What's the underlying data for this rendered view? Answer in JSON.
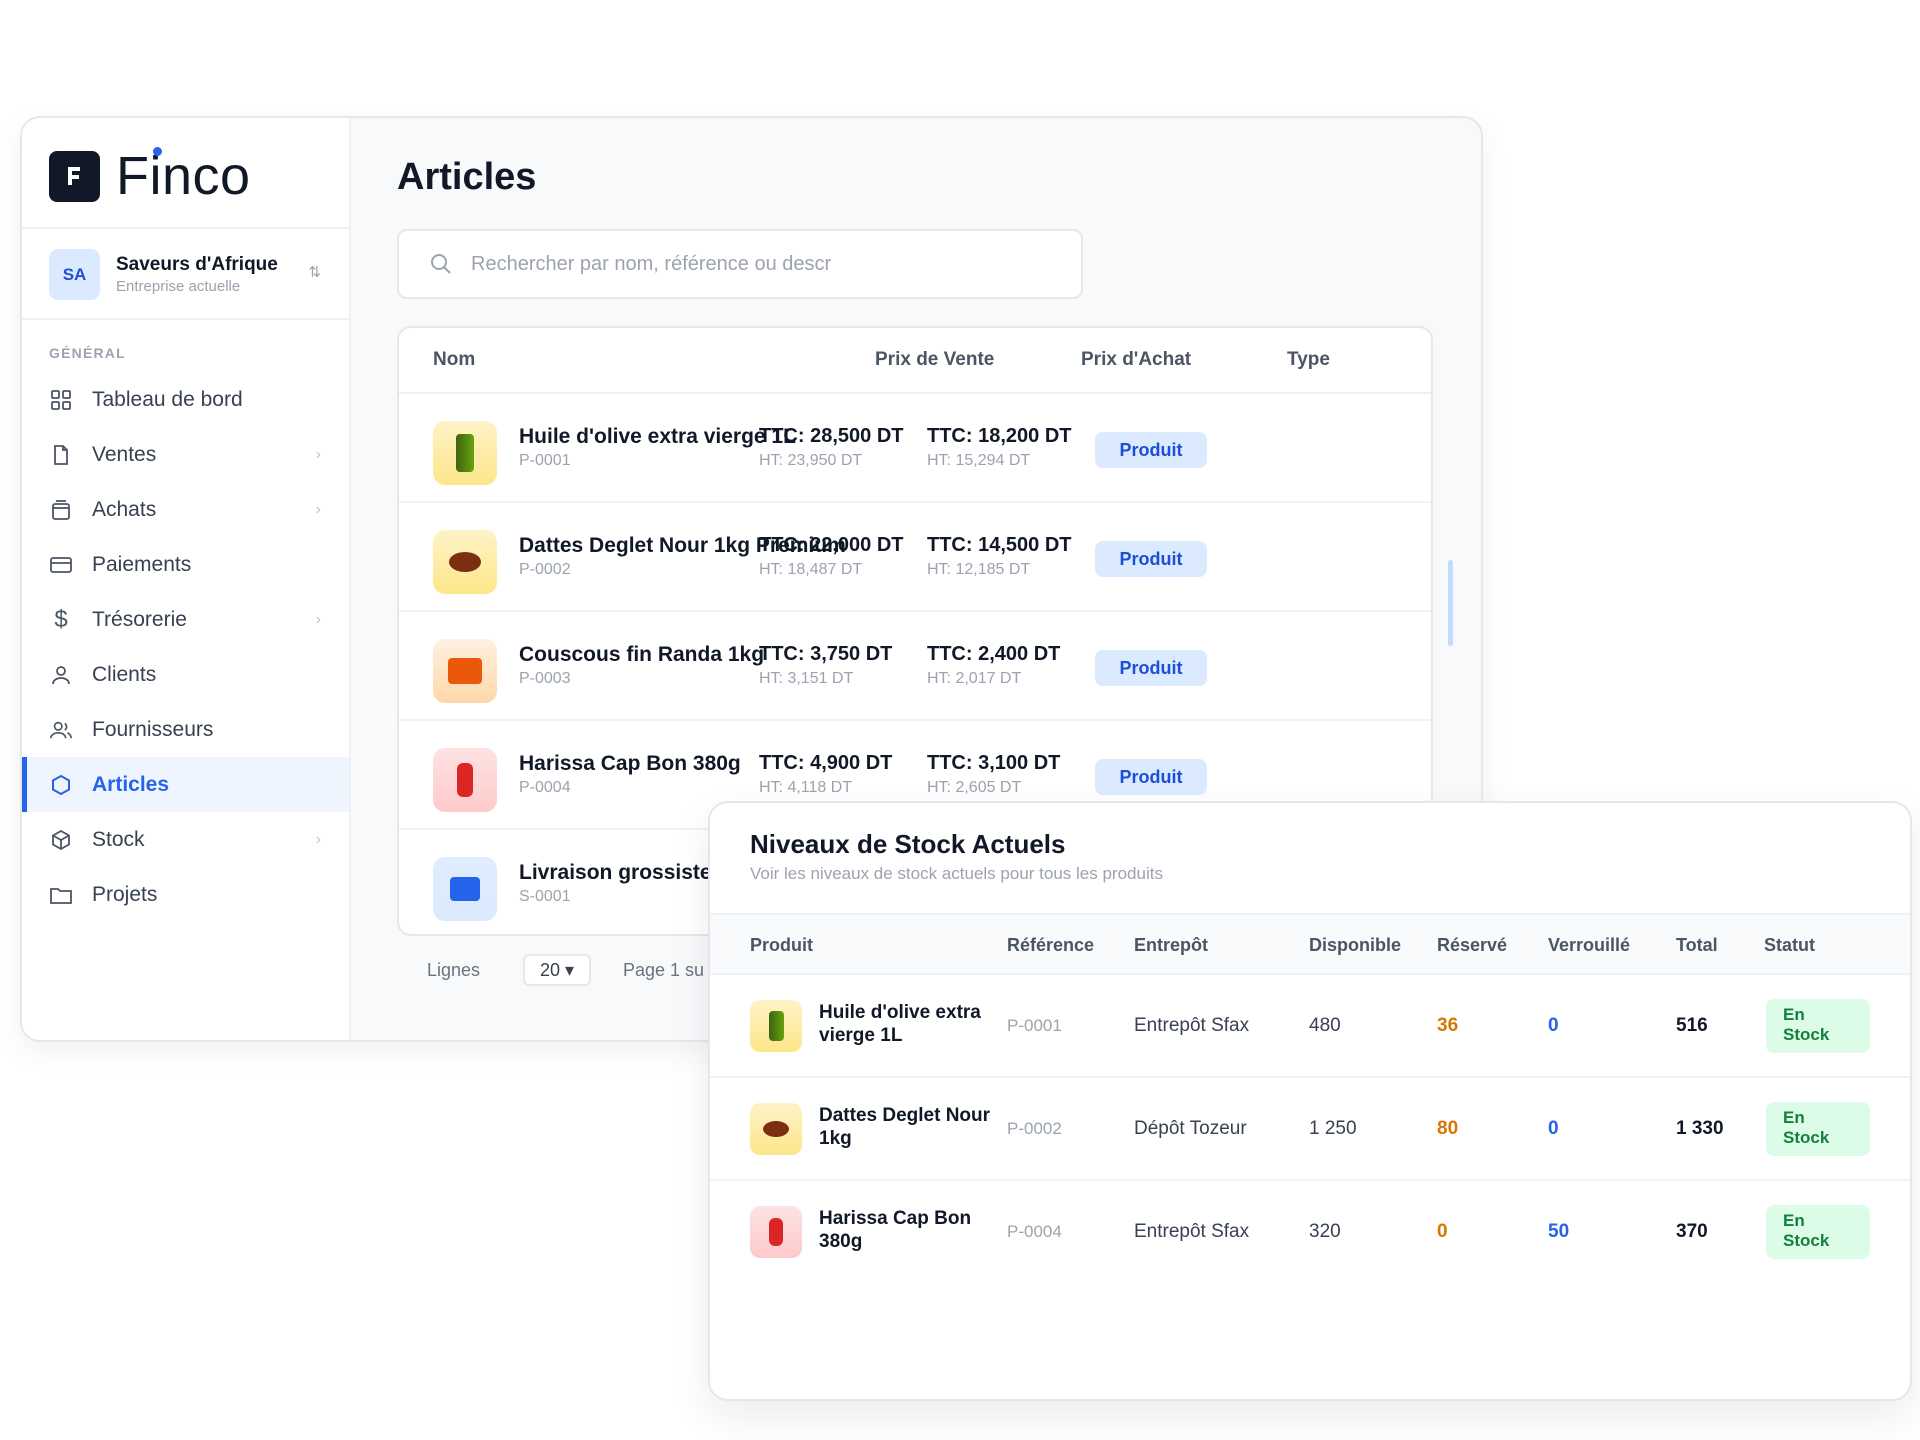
{
  "app": {
    "name": "Finco"
  },
  "company": {
    "initials": "SA",
    "name": "Saveurs d'Afrique",
    "subtitle": "Entreprise actuelle"
  },
  "sidebar": {
    "section_label": "GÉNÉRAL",
    "items": [
      {
        "label": "Tableau de bord",
        "icon": "dashboard-icon",
        "chevron": false,
        "active": false
      },
      {
        "label": "Ventes",
        "icon": "document-icon",
        "chevron": true,
        "active": false
      },
      {
        "label": "Achats",
        "icon": "shopping-bag-icon",
        "chevron": true,
        "active": false
      },
      {
        "label": "Paiements",
        "icon": "credit-card-icon",
        "chevron": false,
        "active": false
      },
      {
        "label": "Trésorerie",
        "icon": "dollar-icon",
        "chevron": true,
        "active": false
      },
      {
        "label": "Clients",
        "icon": "user-icon",
        "chevron": false,
        "active": false
      },
      {
        "label": "Fournisseurs",
        "icon": "users-icon",
        "chevron": false,
        "active": false
      },
      {
        "label": "Articles",
        "icon": "hexagon-icon",
        "chevron": false,
        "active": true
      },
      {
        "label": "Stock",
        "icon": "box-icon",
        "chevron": true,
        "active": false
      },
      {
        "label": "Projets",
        "icon": "folder-icon",
        "chevron": false,
        "active": false
      }
    ]
  },
  "articles": {
    "title": "Articles",
    "search_placeholder": "Rechercher par nom, référence ou descr",
    "columns": {
      "name": "Nom",
      "sell_price": "Prix de Vente",
      "buy_price": "Prix d'Achat",
      "type": "Type"
    },
    "rows": [
      {
        "name": "Huile d'olive extra vierge 1L",
        "ref": "P-0001",
        "sell_ttc": "TTC: 28,500 DT",
        "sell_ht": "HT: 23,950 DT",
        "buy_ttc": "TTC: 18,200 DT",
        "buy_ht": "HT: 15,294 DT",
        "type": "Produit",
        "thumb": "olive-oil-bottle"
      },
      {
        "name": "Dattes Deglet Nour 1kg Premium",
        "ref": "P-0002",
        "sell_ttc": "TTC: 22,000 DT",
        "sell_ht": "HT: 18,487 DT",
        "buy_ttc": "TTC: 14,500 DT",
        "buy_ht": "HT: 12,185 DT",
        "type": "Produit",
        "thumb": "dates"
      },
      {
        "name": "Couscous fin Randa 1kg",
        "ref": "P-0003",
        "sell_ttc": "TTC: 3,750 DT",
        "sell_ht": "HT: 3,151 DT",
        "buy_ttc": "TTC: 2,400 DT",
        "buy_ht": "HT: 2,017 DT",
        "type": "Produit",
        "thumb": "couscous-box"
      },
      {
        "name": "Harissa Cap Bon 380g",
        "ref": "P-0004",
        "sell_ttc": "TTC: 4,900 DT",
        "sell_ht": "HT: 4,118 DT",
        "buy_ttc": "TTC: 3,100 DT",
        "buy_ht": "HT: 2,605 DT",
        "type": "Produit",
        "thumb": "harissa-jar"
      },
      {
        "name": "Livraison grossiste",
        "ref": "S-0001",
        "thumb": "service"
      }
    ],
    "pager": {
      "rows_label": "Lignes",
      "page_size": "20 ▾",
      "page_text": "Page 1 su"
    }
  },
  "stock": {
    "title": "Niveaux de Stock Actuels",
    "subtitle": "Voir les niveaux de stock actuels pour tous les produits",
    "columns": {
      "product": "Produit",
      "ref": "Référence",
      "warehouse": "Entrepôt",
      "available": "Disponible",
      "reserved": "Réservé",
      "locked": "Verrouillé",
      "total": "Total",
      "status": "Statut"
    },
    "rows": [
      {
        "name": "Huile d'olive extra vierge 1L",
        "ref": "P-0001",
        "warehouse": "Entrepôt Sfax",
        "available": "480",
        "reserved": "36",
        "locked": "0",
        "total": "516",
        "status_line1": "En",
        "status_line2": "Stock",
        "thumb": "olive-oil-bottle"
      },
      {
        "name": "Dattes Deglet Nour 1kg",
        "ref": "P-0002",
        "warehouse": "Dépôt Tozeur",
        "available": "1 250",
        "reserved": "80",
        "locked": "0",
        "total": "1 330",
        "status_line1": "En",
        "status_line2": "Stock",
        "thumb": "dates"
      },
      {
        "name": "Harissa Cap Bon 380g",
        "ref": "P-0004",
        "warehouse": "Entrepôt Sfax",
        "available": "320",
        "reserved": "0",
        "locked": "50",
        "total": "370",
        "status_line1": "En",
        "status_line2": "Stock",
        "thumb": "harissa-jar"
      }
    ]
  },
  "colors": {
    "accent": "#2563eb",
    "badge_bg": "#dbeafe",
    "stock_badge_bg": "#dcfce7",
    "reserved": "#d97706"
  }
}
